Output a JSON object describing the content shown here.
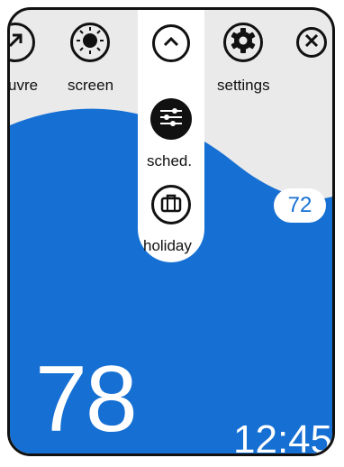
{
  "toolbar": {
    "items": [
      {
        "label": "uvre",
        "icon": "arrow-up-right-icon"
      },
      {
        "label": "screen",
        "icon": "brightness-icon"
      },
      {
        "label": "settings",
        "icon": "gear-icon"
      },
      {
        "label": "",
        "icon": "close-icon"
      }
    ]
  },
  "menu": {
    "collapse_icon": "chevron-up-icon",
    "items": [
      {
        "label": "sched.",
        "icon": "sliders-icon"
      },
      {
        "label": "holiday",
        "icon": "briefcase-icon"
      }
    ]
  },
  "thermostat": {
    "setpoint": "72",
    "current_temp": "78",
    "time": "12:45"
  },
  "colors": {
    "accent": "#1670d3",
    "background": "#eaeaea",
    "ink": "#111111"
  }
}
